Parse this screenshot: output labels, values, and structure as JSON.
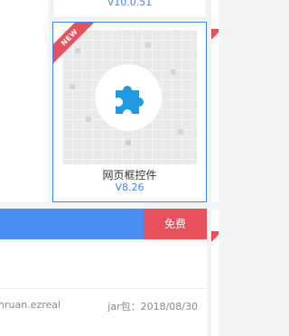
{
  "top_card": {
    "version": "V10.0.51"
  },
  "main_card": {
    "badge": "NEW",
    "name": "网页框控件",
    "version": "V8.26",
    "icon": "puzzle-piece-icon",
    "icon_color": "#1e9be0"
  },
  "row": {
    "free_label": "免费",
    "author": "nruan.ezreal",
    "meta": "jar包：2018/08/30"
  },
  "colors": {
    "accent_blue": "#3d86f0",
    "badge_red": "#e8505b",
    "bar_blue": "#4a8ef0"
  }
}
